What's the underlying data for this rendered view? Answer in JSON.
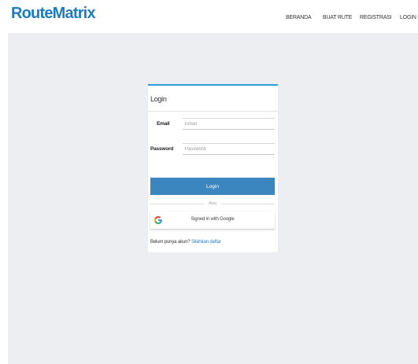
{
  "header": {
    "brand": "RouteMatrix",
    "nav": [
      {
        "label": "BERANDA"
      },
      {
        "label": "BUAT RUTE"
      },
      {
        "label": "REGISTRASI"
      },
      {
        "label": "LOGIN"
      }
    ]
  },
  "login_card": {
    "title": "Login",
    "email": {
      "label": "Email",
      "placeholder": "Email",
      "value": ""
    },
    "password": {
      "label": "Password",
      "placeholder": "Password",
      "value": ""
    },
    "login_button": "Login",
    "divider_text": "Atau",
    "google_button": "Signed in with Google",
    "google_icon": "google-icon",
    "register_prompt": "Belum punya akun?",
    "register_link": "Silahkan daftar"
  },
  "colors": {
    "brand": "#1d7bbf",
    "page_background": "#eceef1",
    "card_accent": "#2a9fd6",
    "login_button": "#3b86bf",
    "link": "#2a7dc6"
  }
}
